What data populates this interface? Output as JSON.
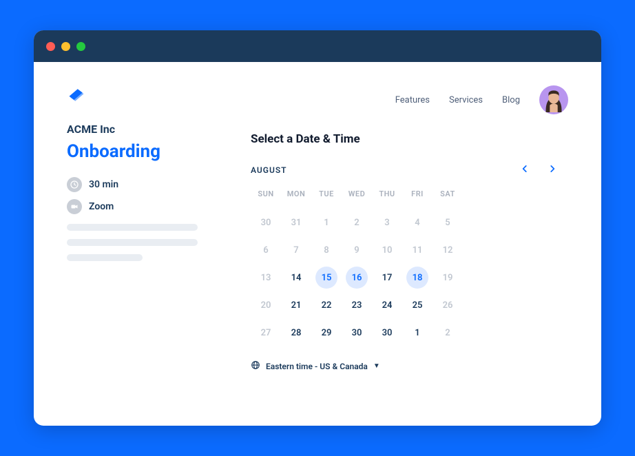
{
  "nav": {
    "features": "Features",
    "services": "Services",
    "blog": "Blog"
  },
  "left": {
    "company": "ACME Inc",
    "event_title": "Onboarding",
    "duration": "30 min",
    "platform": "Zoom"
  },
  "right": {
    "heading": "Select a Date & Time",
    "month": "AUGUST",
    "timezone": "Eastern time - US & Canada",
    "dow": [
      "SUN",
      "MON",
      "TUE",
      "WED",
      "THU",
      "FRI",
      "SAT"
    ],
    "days": [
      {
        "n": "30",
        "state": "inactive"
      },
      {
        "n": "31",
        "state": "inactive"
      },
      {
        "n": "1",
        "state": "inactive"
      },
      {
        "n": "2",
        "state": "inactive"
      },
      {
        "n": "3",
        "state": "inactive"
      },
      {
        "n": "4",
        "state": "inactive"
      },
      {
        "n": "5",
        "state": "inactive"
      },
      {
        "n": "6",
        "state": "inactive"
      },
      {
        "n": "7",
        "state": "inactive"
      },
      {
        "n": "8",
        "state": "inactive"
      },
      {
        "n": "9",
        "state": "inactive"
      },
      {
        "n": "10",
        "state": "inactive"
      },
      {
        "n": "11",
        "state": "inactive"
      },
      {
        "n": "12",
        "state": "inactive"
      },
      {
        "n": "13",
        "state": "inactive"
      },
      {
        "n": "14",
        "state": "active"
      },
      {
        "n": "15",
        "state": "highlight"
      },
      {
        "n": "16",
        "state": "highlight"
      },
      {
        "n": "17",
        "state": "active"
      },
      {
        "n": "18",
        "state": "highlight"
      },
      {
        "n": "19",
        "state": "inactive"
      },
      {
        "n": "20",
        "state": "inactive"
      },
      {
        "n": "21",
        "state": "active"
      },
      {
        "n": "22",
        "state": "active"
      },
      {
        "n": "23",
        "state": "active"
      },
      {
        "n": "24",
        "state": "active"
      },
      {
        "n": "25",
        "state": "active"
      },
      {
        "n": "26",
        "state": "inactive"
      },
      {
        "n": "27",
        "state": "inactive"
      },
      {
        "n": "28",
        "state": "active"
      },
      {
        "n": "29",
        "state": "active"
      },
      {
        "n": "30",
        "state": "active"
      },
      {
        "n": "30",
        "state": "active"
      },
      {
        "n": "1",
        "state": "active"
      },
      {
        "n": "2",
        "state": "inactive"
      }
    ]
  }
}
